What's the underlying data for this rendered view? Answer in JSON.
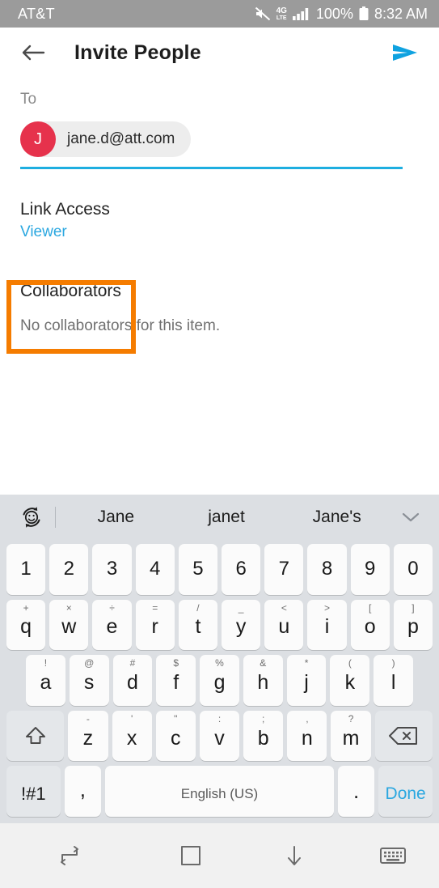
{
  "status_bar": {
    "carrier": "AT&T",
    "network": "4G",
    "network_sub": "LTE",
    "battery_percent": "100%",
    "time": "8:32 AM",
    "icons": [
      "mute-icon",
      "signal-icon",
      "battery-icon"
    ]
  },
  "header": {
    "title": "Invite People",
    "back_icon": "back-arrow-icon",
    "send_icon": "send-icon",
    "send_color": "#0fa2e0"
  },
  "form": {
    "to_label": "To",
    "recipient": {
      "initial": "J",
      "email": "jane.d@att.com",
      "avatar_color": "#e6324c"
    },
    "underline_color": "#1eaee0"
  },
  "link_access": {
    "title": "Link Access",
    "value": "Viewer",
    "value_color": "#2aa7e0",
    "highlight_color": "#f57c00"
  },
  "collaborators": {
    "title": "Collaborators",
    "empty_message": "No collaborators for this item."
  },
  "suggestion_bar": {
    "emoji_icon": "emoji-sticker-icon",
    "suggestions": [
      "Jane",
      "janet",
      "Jane's"
    ],
    "expand_icon": "chevron-down-icon"
  },
  "keyboard": {
    "rows": {
      "numbers": [
        "1",
        "2",
        "3",
        "4",
        "5",
        "6",
        "7",
        "8",
        "9",
        "0"
      ],
      "qwerty": [
        {
          "main": "q",
          "sup": "+"
        },
        {
          "main": "w",
          "sup": "×"
        },
        {
          "main": "e",
          "sup": "÷"
        },
        {
          "main": "r",
          "sup": "="
        },
        {
          "main": "t",
          "sup": "/"
        },
        {
          "main": "y",
          "sup": "_"
        },
        {
          "main": "u",
          "sup": "<"
        },
        {
          "main": "i",
          "sup": ">"
        },
        {
          "main": "o",
          "sup": "["
        },
        {
          "main": "p",
          "sup": "]"
        }
      ],
      "asdf": [
        {
          "main": "a",
          "sup": "!"
        },
        {
          "main": "s",
          "sup": "@"
        },
        {
          "main": "d",
          "sup": "#"
        },
        {
          "main": "f",
          "sup": "$"
        },
        {
          "main": "g",
          "sup": "%"
        },
        {
          "main": "h",
          "sup": "&"
        },
        {
          "main": "j",
          "sup": "*"
        },
        {
          "main": "k",
          "sup": "("
        },
        {
          "main": "l",
          "sup": ")"
        }
      ],
      "zxcv": [
        {
          "main": "z",
          "sup": "-"
        },
        {
          "main": "x",
          "sup": "'"
        },
        {
          "main": "c",
          "sup": "\""
        },
        {
          "main": "v",
          "sup": ":"
        },
        {
          "main": "b",
          "sup": ";"
        },
        {
          "main": "n",
          "sup": ","
        },
        {
          "main": "m",
          "sup": "?"
        }
      ]
    },
    "shift_icon": "shift-icon",
    "backspace_icon": "backspace-icon",
    "symbols_key": "!#1",
    "comma_key": ",",
    "space_key": "English (US)",
    "period_key": ".",
    "done_key": "Done",
    "done_color": "#2aa7e0"
  },
  "nav_bar": {
    "recents_icon": "recents-icon",
    "home_icon": "home-icon",
    "hide_keyboard_icon": "arrow-down-icon",
    "keyboard_switch_icon": "keyboard-icon"
  }
}
